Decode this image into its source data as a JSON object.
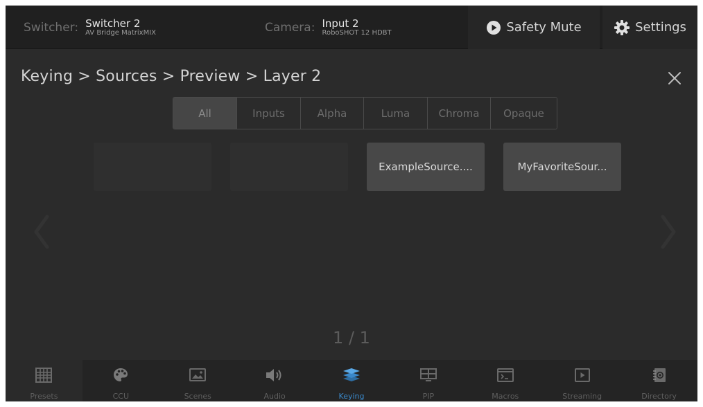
{
  "topbar": {
    "switcher_key": "Switcher:",
    "switcher_name": "Switcher 2",
    "switcher_model": "AV Bridge MatrixMIX",
    "camera_key": "Camera:",
    "camera_name": "Input 2",
    "camera_model": "RoboSHOT 12 HDBT",
    "safety_mute_label": "Safety Mute",
    "settings_label": "Settings"
  },
  "header": {
    "breadcrumb": "Keying > Sources > Preview > Layer 2"
  },
  "filters": {
    "tabs": [
      "All",
      "Inputs",
      "Alpha",
      "Luma",
      "Chroma",
      "Opaque"
    ],
    "active": "All"
  },
  "sources": {
    "tiles": [
      "ExampleSource....",
      "MyFavoriteSour..."
    ]
  },
  "pager": {
    "text": "1 / 1"
  },
  "bottomnav": {
    "items": [
      "Presets",
      "CCU",
      "Scenes",
      "Audio",
      "Keying",
      "PIP",
      "Macros",
      "Streaming",
      "Directory"
    ],
    "active": "Keying"
  },
  "colors": {
    "accent": "#3a88c9",
    "background": "#2b2b2b",
    "topbar": "#202020"
  },
  "icons": {
    "safety_mute": "play-circle-icon",
    "settings": "gear-icon",
    "close": "close-icon",
    "prev": "chevron-left-icon",
    "next": "chevron-right-icon"
  }
}
